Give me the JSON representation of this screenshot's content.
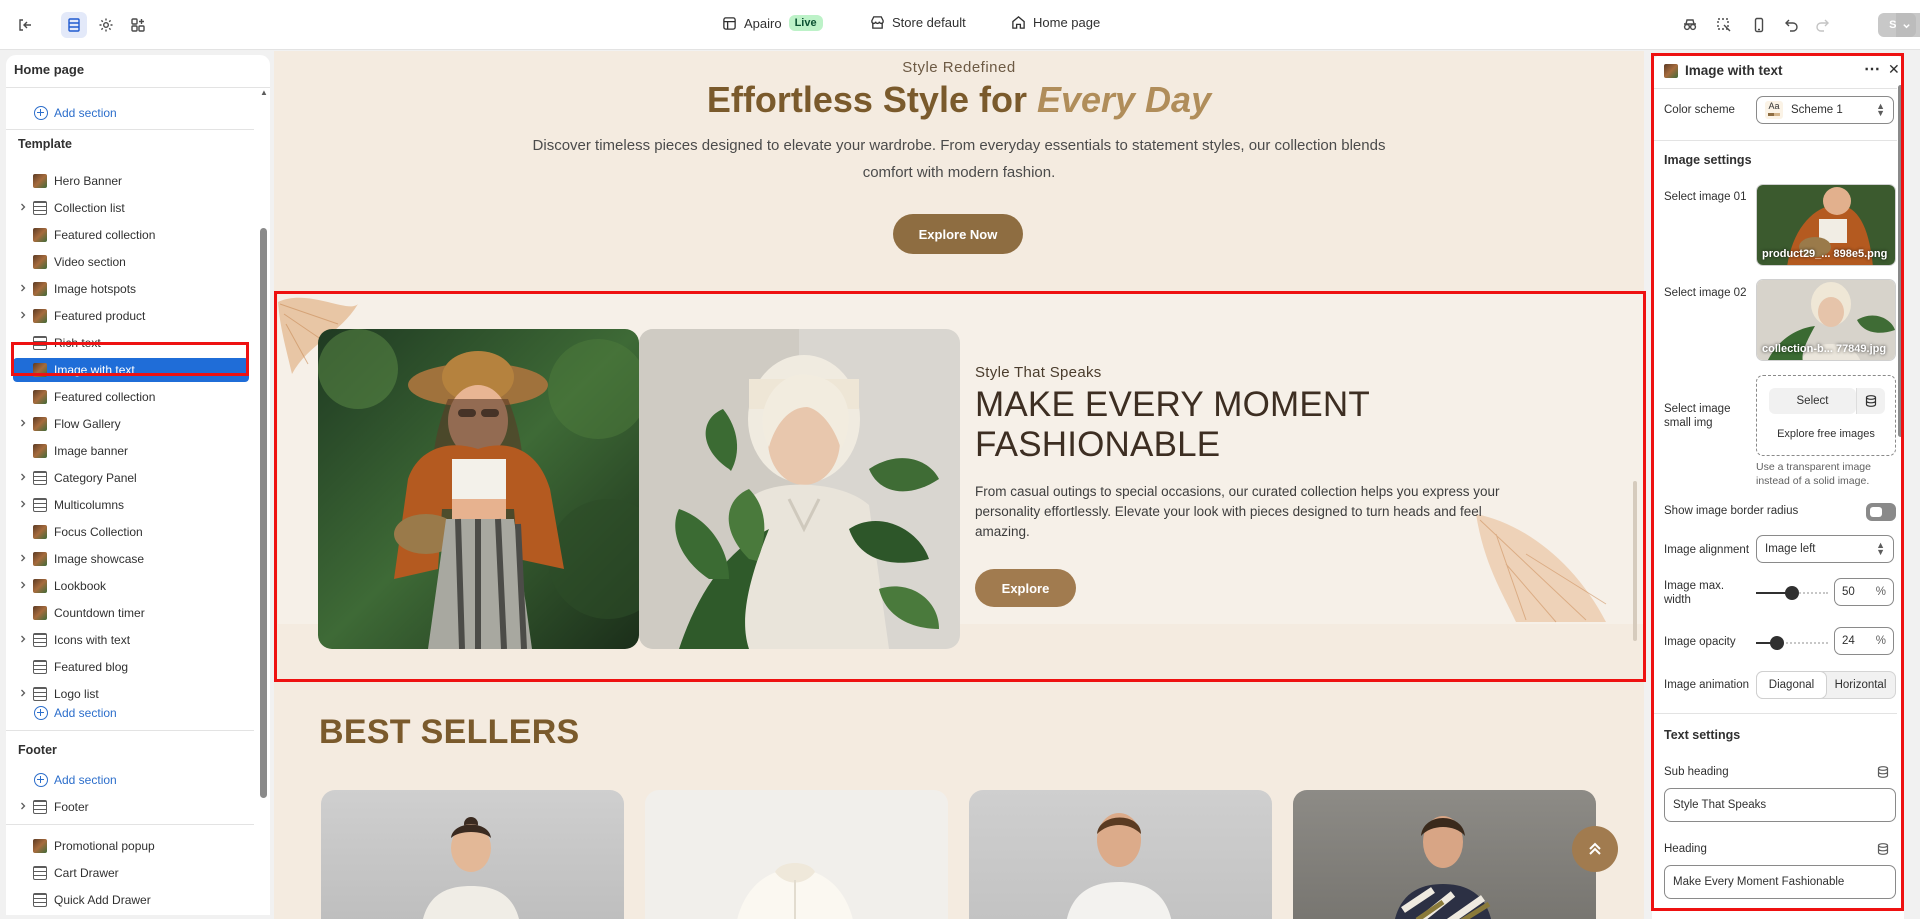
{
  "topbar": {
    "store_name": "Apairo",
    "live_badge": "Live",
    "theme_label": "Store default",
    "page_label": "Home page",
    "save_label": "Save"
  },
  "sidebar": {
    "title": "Home page",
    "add_section": "Add section",
    "template_label": "Template",
    "items": [
      {
        "label": "Hero Banner",
        "expandable": false,
        "icon": "image-icon"
      },
      {
        "label": "Collection list",
        "expandable": true,
        "icon": "grid-icon"
      },
      {
        "label": "Featured collection",
        "expandable": false,
        "icon": "image-icon"
      },
      {
        "label": "Video section",
        "expandable": false,
        "icon": "image-icon"
      },
      {
        "label": "Image hotspots",
        "expandable": true,
        "icon": "image-icon"
      },
      {
        "label": "Featured product",
        "expandable": true,
        "icon": "image-icon"
      },
      {
        "label": "Rich text",
        "expandable": false,
        "icon": "text-icon"
      },
      {
        "label": "Image with text",
        "expandable": false,
        "icon": "image-icon",
        "selected": true
      },
      {
        "label": "Featured collection",
        "expandable": false,
        "icon": "image-icon"
      },
      {
        "label": "Flow Gallery",
        "expandable": true,
        "icon": "image-icon"
      },
      {
        "label": "Image banner",
        "expandable": false,
        "icon": "image-icon"
      },
      {
        "label": "Category Panel",
        "expandable": true,
        "icon": "grid-icon"
      },
      {
        "label": "Multicolumns",
        "expandable": true,
        "icon": "grid-icon"
      },
      {
        "label": "Focus Collection",
        "expandable": false,
        "icon": "image-icon"
      },
      {
        "label": "Image showcase",
        "expandable": true,
        "icon": "image-icon"
      },
      {
        "label": "Lookbook",
        "expandable": true,
        "icon": "image-icon"
      },
      {
        "label": "Countdown timer",
        "expandable": false,
        "icon": "image-icon"
      },
      {
        "label": "Icons with text",
        "expandable": true,
        "icon": "text-icon"
      },
      {
        "label": "Featured blog",
        "expandable": false,
        "icon": "text-icon"
      },
      {
        "label": "Logo list",
        "expandable": true,
        "icon": "logo-icon"
      }
    ],
    "footer_label": "Footer",
    "footer_items": [
      {
        "label": "Footer",
        "expandable": true,
        "icon": "grid-icon"
      }
    ],
    "overlay_items": [
      {
        "label": "Promotional popup",
        "icon": "image-icon"
      },
      {
        "label": "Cart Drawer",
        "icon": "grid-icon"
      },
      {
        "label": "Quick Add Drawer",
        "icon": "grid-icon"
      }
    ]
  },
  "preview": {
    "hero": {
      "subtitle": "Style Redefined",
      "title_plain": "Effortless Style for ",
      "title_italic": "Every Day",
      "description": "Discover timeless pieces designed to elevate your wardrobe. From everyday essentials to statement styles, our collection blends comfort with modern fashion.",
      "button": "Explore Now"
    },
    "image_with_text": {
      "subheading": "Style That Speaks",
      "heading": "MAKE EVERY MOMENT FASHIONABLE",
      "text": "From casual outings to special occasions, our curated collection helps you express your personality effortlessly. Elevate your look with pieces designed to turn heads and feel amazing.",
      "button": "Explore"
    },
    "best_sellers_title": "BEST SELLERS"
  },
  "settings": {
    "title": "Image with text",
    "color_scheme_label": "Color scheme",
    "color_scheme_value": "Scheme 1",
    "color_scheme_chip": "Aa",
    "image_settings_label": "Image settings",
    "select_image_01_label": "Select image 01",
    "select_image_01_file": "product29_... 898e5.png",
    "select_image_02_label": "Select image 02",
    "select_image_02_file": "collection-b... 77849.jpg",
    "select_small_img_label": "Select image small img",
    "select_button": "Select",
    "explore_free_images": "Explore free images",
    "small_img_hint": "Use a transparent image instead of a solid image.",
    "border_radius_label": "Show image border radius",
    "border_radius_on": false,
    "alignment_label": "Image alignment",
    "alignment_value": "Image left",
    "max_width_label": "Image max. width",
    "max_width_value": "50",
    "opacity_label": "Image opacity",
    "opacity_value": "24",
    "percent": "%",
    "animation_label": "Image animation",
    "animation_options": [
      "Diagonal",
      "Horizontal"
    ],
    "animation_selected": "Diagonal",
    "text_settings_label": "Text settings",
    "sub_heading_label": "Sub heading",
    "sub_heading_value": "Style That Speaks",
    "heading_label": "Heading",
    "heading_value": "Make Every Moment Fashionable"
  },
  "colors": {
    "accent_blue": "#1f6dd8",
    "brand_brown": "#8e6d41",
    "canvas_bg": "#f4ebe0",
    "highlight_red": "#e11111"
  }
}
